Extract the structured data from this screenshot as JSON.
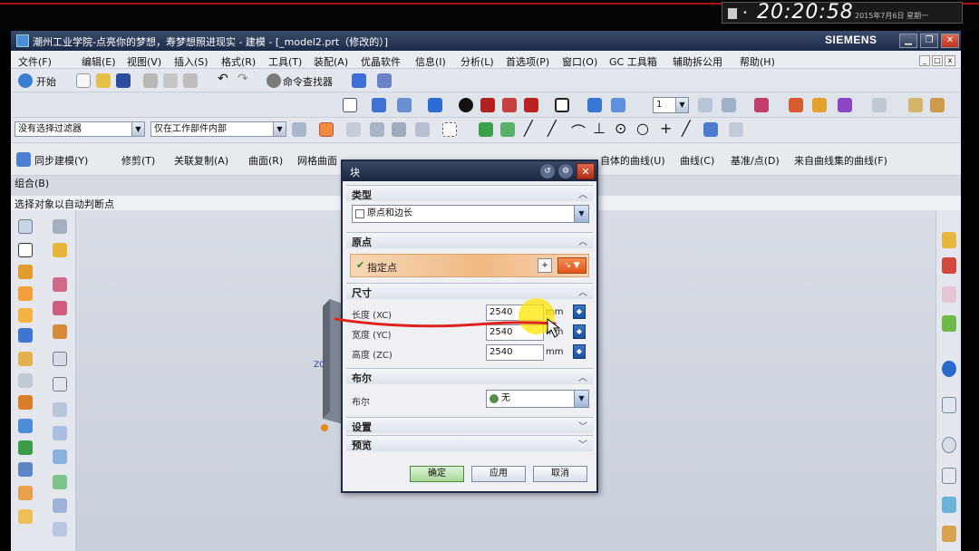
{
  "clock": {
    "time": "20:20:58",
    "date": "2015年7月6日 星期一"
  },
  "window": {
    "title": "潮州工业学院-点亮你的梦想，寿梦想照进现实 - 建模 - [_model2.prt（修改的）]",
    "brand": "SIEMENS",
    "controls": {
      "minimize": "▁",
      "restore": "❐",
      "close": "✕"
    }
  },
  "menu": [
    "文件(F)",
    "编辑(E)",
    "视图(V)",
    "插入(S)",
    "格式(R)",
    "工具(T)",
    "装配(A)",
    "优晶软件",
    "信息(I)",
    "分析(L)",
    "首选项(P)",
    "窗口(O)",
    "GC 工具箱",
    "辅助拆公用",
    "帮助(H)"
  ],
  "standard_toolbar": {
    "start": "开始",
    "command_finder": "命令查找器"
  },
  "selection_bar": {
    "filter": "没有选择过滤器",
    "scope": "仅在工作部件内部",
    "layer_value": "1"
  },
  "feature_toolbar": [
    "同步建模(Y)",
    "修剪(T)",
    "关联复制(A)",
    "曲面(R)",
    "网格曲面",
    "自体的曲线(U)",
    "曲线(C)",
    "基准/点(D)",
    "来自曲线集的曲线(F)"
  ],
  "combo_label": "组合(B)",
  "status_text": "选择对象以自动判断点",
  "viewport": {
    "axis_label": "ZC"
  },
  "dialog": {
    "title": "块",
    "sections": {
      "type": "类型",
      "origin": "原点",
      "dimensions": "尺寸",
      "boolean": "布尔",
      "settings": "设置",
      "preview": "预览"
    },
    "type_value": "原点和边长",
    "specify_point": "指定点",
    "dimensions": [
      {
        "label": "长度 (XC)",
        "value": "2540",
        "unit": "mm"
      },
      {
        "label": "宽度 (YC)",
        "value": "2540",
        "unit": "mm"
      },
      {
        "label": "高度 (ZC)",
        "value": "2540",
        "unit": "mm"
      }
    ],
    "boolean_label": "布尔",
    "boolean_value": "无",
    "buttons": {
      "ok": "确定",
      "apply": "应用",
      "cancel": "取消"
    }
  },
  "colors": {
    "annotation_line": "#e0221f",
    "highlight": "#ffe600",
    "ok_button": "#a7d897",
    "point_row": "#f1b984"
  }
}
